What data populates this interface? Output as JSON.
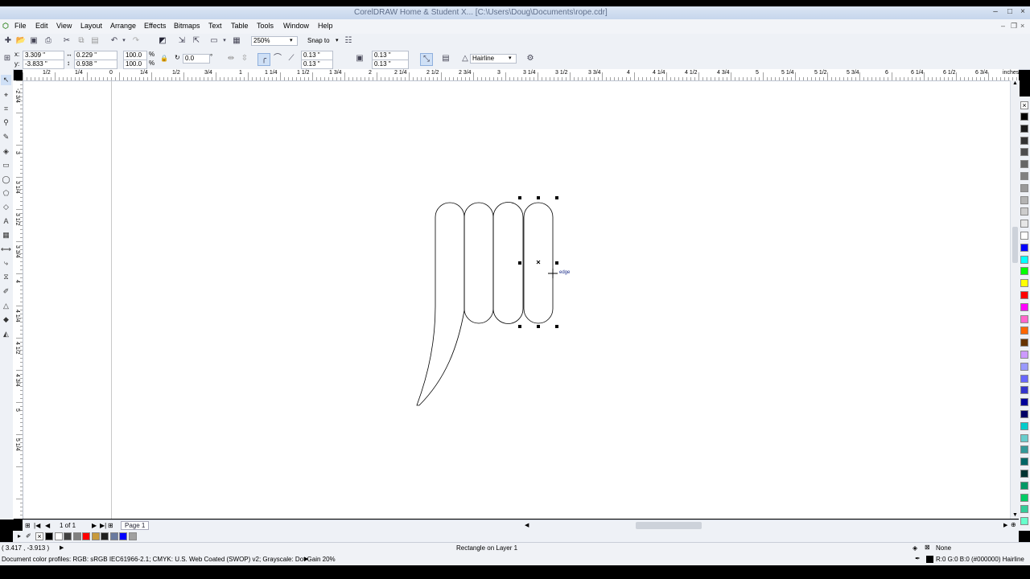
{
  "window": {
    "title": "CorelDRAW Home & Student X... [C:\\Users\\Doug\\Documents\\rope.cdr]",
    "minimize": "–",
    "maximize": "□",
    "close": "×"
  },
  "menu": [
    "File",
    "Edit",
    "View",
    "Layout",
    "Arrange",
    "Effects",
    "Bitmaps",
    "Text",
    "Table",
    "Tools",
    "Window",
    "Help"
  ],
  "standard_toolbar": {
    "zoom": "250%",
    "snap_to": "Snap to"
  },
  "property_bar": {
    "x": "3.309 \"",
    "y": "-3.833 \"",
    "width": "0.229 \"",
    "height": "0.938 \"",
    "scale_x": "100.0",
    "scale_y": "100.0",
    "percent": "%",
    "rotation": "0.0",
    "degree": "°",
    "corner_tl": "0.13 \"",
    "corner_bl": "0.13 \"",
    "corner_tr": "0.13 \"",
    "corner_br": "0.13 \"",
    "outline": "Hairline",
    "x_label": "x:",
    "y_label": "y:"
  },
  "ruler": {
    "unit": "inches",
    "h_labels": [
      "1/2",
      "1/4",
      "0",
      "1/4",
      "1/2",
      "3/4",
      "1",
      "1 1/4",
      "1 1/2",
      "1 3/4",
      "2",
      "2 1/4",
      "2 1/2",
      "2 3/4",
      "3",
      "3 1/4",
      "3 1/2",
      "3 3/4",
      "4",
      "4 1/4",
      "4 1/2",
      "4 3/4",
      "5",
      "5 1/4",
      "5 1/2",
      "5 3/4",
      "6",
      "6 1/4",
      "6 1/2",
      "6 3/4"
    ],
    "v_labels": [
      "-2 3/4",
      "3",
      "3 1/4",
      "3 1/2",
      "3 3/4",
      "4",
      "4 1/4",
      "4 1/2",
      "4 3/4",
      "5",
      "5 1/4"
    ]
  },
  "canvas": {
    "snap_hint": "edge"
  },
  "page_nav": {
    "page_count": "1 of 1",
    "page_tab": "Page 1"
  },
  "status": {
    "cursor": "( 3.417 , -3.913 )",
    "selection": "Rectangle on Layer 1",
    "fill_label": "None",
    "color_profiles": "Document color profiles: RGB: sRGB IEC61966-2.1; CMYK: U.S. Web Coated (SWOP) v2; Grayscale: Dot Gain 20%",
    "outline_info": "R:0 G:0 B:0 (#000000)  Hairline"
  },
  "palette": [
    "#000000",
    "#1a1a1a",
    "#333333",
    "#4d4d4d",
    "#666666",
    "#808080",
    "#999999",
    "#b3b3b3",
    "#cccccc",
    "#e6e6e6",
    "#ffffff",
    "#0000ff",
    "#00ffff",
    "#00ff00",
    "#ffff00",
    "#ff0000",
    "#ff00ff",
    "#ff66cc",
    "#ff6600",
    "#663300",
    "#cc99ff",
    "#9999ff",
    "#6666ff",
    "#3333cc",
    "#000099",
    "#000066",
    "#00cccc",
    "#66cccc",
    "#339999",
    "#006666",
    "#003333",
    "#009966",
    "#00cc66",
    "#33cc99",
    "#66ffcc"
  ],
  "doc_palette": [
    "#000000",
    "#ffffff",
    "#404040",
    "#808080",
    "#ff0000",
    "#c89a3c",
    "#202020",
    "#6a7aa0",
    "#0000ff",
    "#a0a0a0"
  ]
}
